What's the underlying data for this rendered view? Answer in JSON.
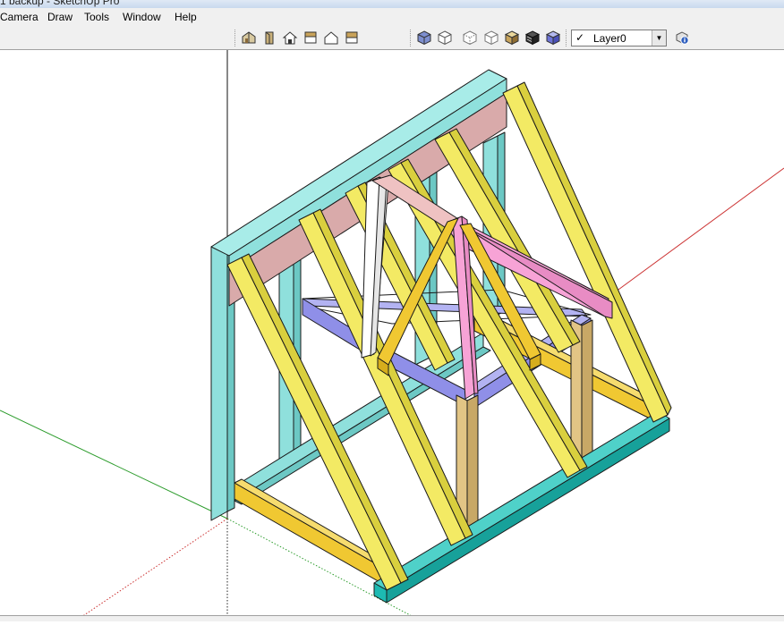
{
  "window": {
    "title": "1 backup - SketchUp Pro"
  },
  "menu": {
    "items": [
      "Camera",
      "Draw",
      "Tools",
      "Window",
      "Help"
    ]
  },
  "toolbar": {
    "views_buttons": [
      "iso-view-icon",
      "top-view-icon",
      "front-view-icon",
      "right-view-icon",
      "back-view-icon",
      "left-view-icon"
    ],
    "style_buttons": [
      "xray-icon",
      "wireframe-icon",
      "hidden-line-icon",
      "shaded-icon",
      "shaded-textures-icon",
      "monochrome-icon"
    ],
    "layer": {
      "check": "✓",
      "value": "Layer0"
    }
  },
  "colors": {
    "wall_post": "#8fe0dc",
    "rafter": "#f3ea64",
    "beam_pink": "#d9aaaa",
    "purlin_blue": "#8f8fe8",
    "hip_pink": "#f7a3d6",
    "brace_gold": "#f0c832",
    "sill_teal": "#1dbab2",
    "post_tan": "#e2c585",
    "white_rafter": "#ffffff"
  }
}
